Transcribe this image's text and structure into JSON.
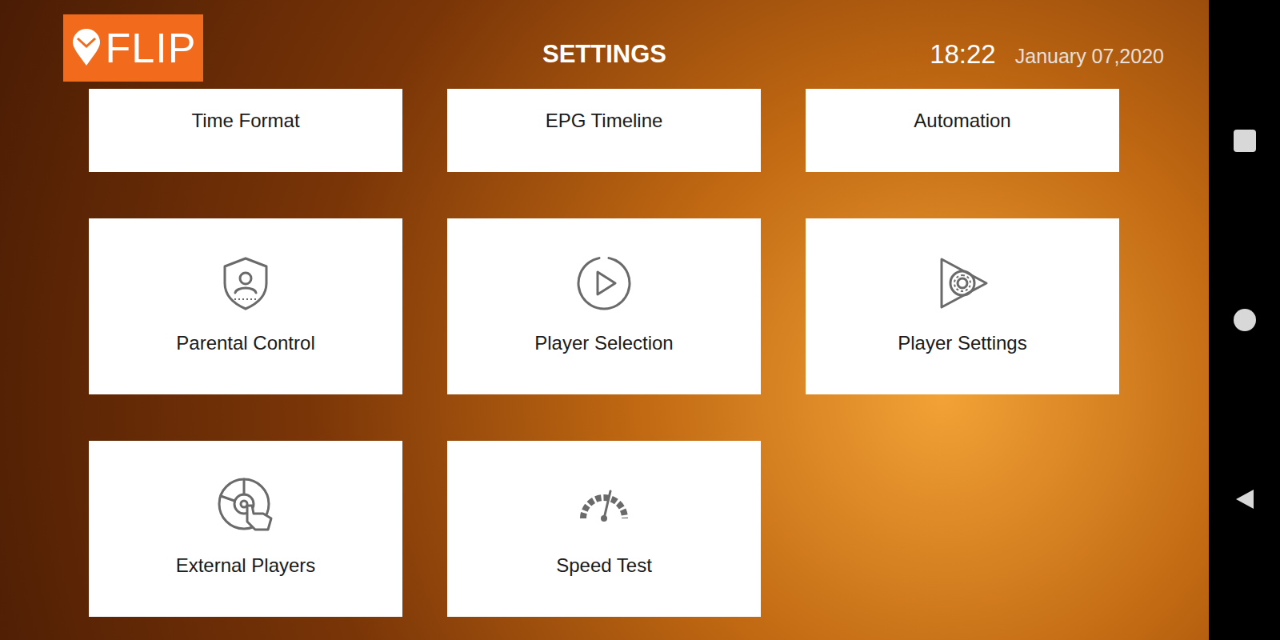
{
  "header": {
    "logo": "FLIP",
    "title": "SETTINGS",
    "time": "18:22",
    "date": "January 07,2020"
  },
  "settings": [
    {
      "label": "Time Format",
      "kind": "time-format"
    },
    {
      "label": "EPG Timeline",
      "kind": "epg-timeline"
    },
    {
      "label": "Automation",
      "kind": "automation"
    },
    {
      "label": "Parental Control",
      "kind": "parental-control"
    },
    {
      "label": "Player Selection",
      "kind": "player-selection"
    },
    {
      "label": "Player Settings",
      "kind": "player-settings"
    },
    {
      "label": "External Players",
      "kind": "external-players"
    },
    {
      "label": "Speed Test",
      "kind": "speed-test"
    }
  ]
}
